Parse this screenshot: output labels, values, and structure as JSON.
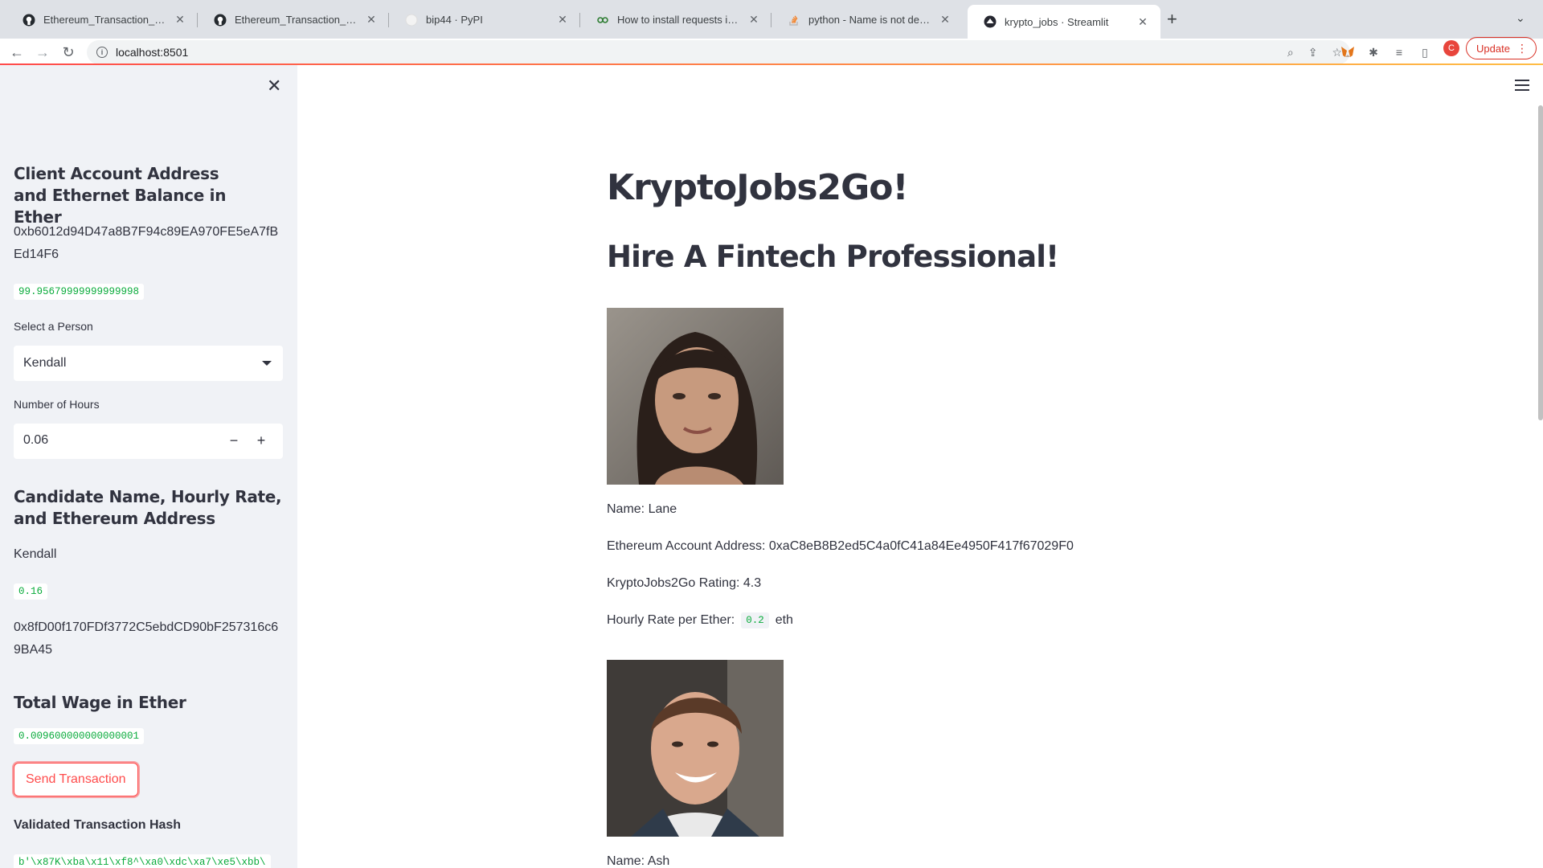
{
  "browser": {
    "tabs": [
      {
        "title": "Ethereum_Transaction_App/kr",
        "icon": "github-icon"
      },
      {
        "title": "Ethereum_Transaction_App/cr",
        "icon": "github-icon"
      },
      {
        "title": "bip44 · PyPI",
        "icon": "pypi-icon"
      },
      {
        "title": "How to install requests in Pyth",
        "icon": "link-icon"
      },
      {
        "title": "python - Name is not defined s",
        "icon": "stackoverflow-icon"
      },
      {
        "title": "krypto_jobs · Streamlit",
        "icon": "streamlit-icon",
        "active": true
      }
    ],
    "url": "localhost:8501",
    "profile_initial": "C",
    "update_label": "Update"
  },
  "sidebar": {
    "client_heading": "Client Account Address and Ethernet Balance in Ether",
    "client_address": "0xb6012d94D47a8B7F94c89EA970FE5eA7fBEd14F6",
    "client_balance": "99.95679999999999998",
    "select_label": "Select a Person",
    "selected_person": "Kendall",
    "hours_label": "Number of Hours",
    "hours_value": "0.06",
    "candidate_heading": "Candidate Name, Hourly Rate, and Ethereum Address",
    "candidate_name": "Kendall",
    "candidate_rate": "0.16",
    "candidate_address": "0x8fD00f170FDf3772C5ebdCD90bF257316c69BA45",
    "wage_heading": "Total Wage in Ether",
    "wage_value": "0.009600000000000001",
    "send_label": "Send Transaction",
    "hash_heading": "Validated Transaction Hash",
    "hash_value": "b'\\x87K\\xba\\x11\\xf8^\\xa0\\xdc\\xa7\\xe5\\xbb\\"
  },
  "main": {
    "title": "KryptoJobs2Go!",
    "subtitle": "Hire A Fintech Professional!",
    "candidates": [
      {
        "name_line": "Name: Lane",
        "address_line": "Ethereum Account Address: 0xaC8eB8B2ed5C4a0fC41a84Ee4950F417f67029F0",
        "rating_line": "KryptoJobs2Go Rating: 4.3",
        "rate_prefix": "Hourly Rate per Ether:",
        "rate_value": "0.2",
        "rate_suffix": "eth"
      },
      {
        "name_line": "Name: Ash"
      }
    ]
  },
  "colors": {
    "accent": "#ff4b4b",
    "code_text": "#09ab3b",
    "sidebar_bg": "#f0f2f6",
    "text": "#31333f"
  }
}
